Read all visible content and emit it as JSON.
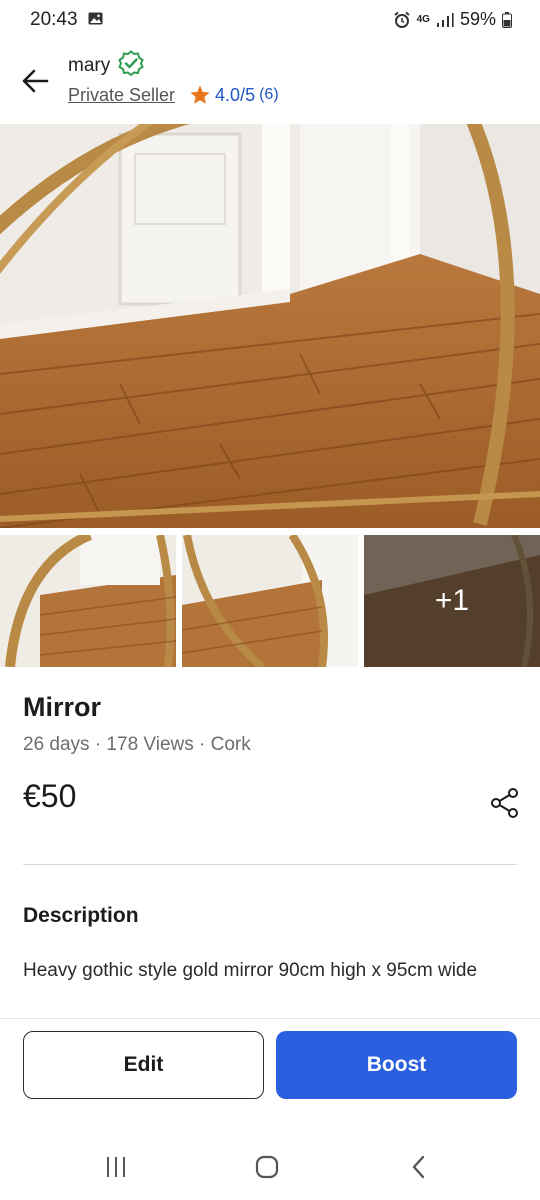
{
  "status_bar": {
    "time": "20:43",
    "network": "4G",
    "battery": "59%"
  },
  "header": {
    "seller_name": "mary",
    "seller_type": "Private Seller",
    "rating": "4.0/5",
    "rating_count": "(6)"
  },
  "gallery": {
    "more_photos": "+1"
  },
  "listing": {
    "title": "Mirror",
    "meta": "26 days · 178 Views · Cork",
    "price": "€50",
    "description_heading": "Description",
    "description": "Heavy gothic style gold mirror 90cm high x 95cm wide"
  },
  "actions": {
    "edit_label": "Edit",
    "boost_label": "Boost"
  },
  "colors": {
    "accent": "#2a5fe0",
    "rating": "#2157c4",
    "verified": "#2e9e4f",
    "star": "#e8761c"
  }
}
